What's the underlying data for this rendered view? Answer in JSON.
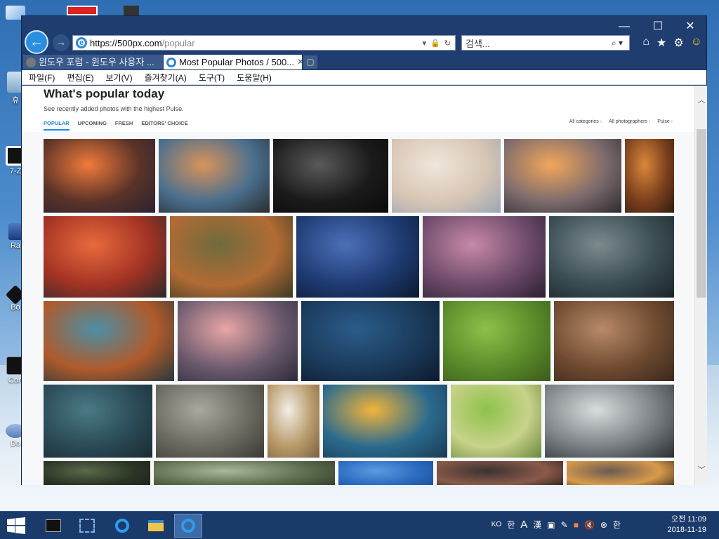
{
  "desktop": {
    "icons": [
      {
        "name": "desktop-icon-recycle",
        "label": "휴"
      },
      {
        "name": "desktop-icon-7zip",
        "label": "7-Z"
      },
      {
        "name": "desktop-icon-ra",
        "label": "Ra"
      },
      {
        "name": "desktop-icon-bo",
        "label": "Bo"
      },
      {
        "name": "desktop-icon-con",
        "label": "Con"
      },
      {
        "name": "desktop-icon-do",
        "label": "Do"
      }
    ]
  },
  "browser": {
    "address": {
      "host": "https://500px.com",
      "path": "/popular"
    },
    "search_placeholder": "검색...",
    "tabs": [
      {
        "label": "윈도우 포럼 - 윈도우 사용자 ...",
        "active": false
      },
      {
        "label": "Most Popular Photos / 500...",
        "active": true
      }
    ],
    "menu": [
      "파일(F)",
      "편집(E)",
      "보기(V)",
      "즐겨찾기(A)",
      "도구(T)",
      "도움말(H)"
    ],
    "window_controls": {
      "minimize": "—",
      "maximize": "☐",
      "close": "✕"
    }
  },
  "page": {
    "title": "What's popular today",
    "subtitle": "See recently added photos with the highest Pulse.",
    "subnav": [
      "POPULAR",
      "UPCOMING",
      "FRESH",
      "EDITORS' CHOICE"
    ],
    "active_subnav": "POPULAR",
    "filters": [
      "All categories",
      "All photographers",
      "Pulse"
    ],
    "photos": [
      {
        "name": "photo-mountain-sunset",
        "colors": [
          "#f07a3b",
          "#5a3328",
          "#2a2230"
        ]
      },
      {
        "name": "photo-lake-rocks",
        "colors": [
          "#d9935a",
          "#4a6f8e",
          "#2a2c2e"
        ]
      },
      {
        "name": "photo-bw-portrait",
        "colors": [
          "#5a5a5a",
          "#1a1a1a",
          "#0a0a0a"
        ]
      },
      {
        "name": "photo-woman-dress",
        "colors": [
          "#efe6dc",
          "#d8c6b4",
          "#9aa5b6"
        ]
      },
      {
        "name": "photo-mountain-clouds",
        "colors": [
          "#f2a75a",
          "#7c6b6d",
          "#2e2a2e"
        ]
      },
      {
        "name": "photo-autumn-forest",
        "colors": [
          "#d9883a",
          "#7a3f1c",
          "#2f1c10"
        ]
      },
      {
        "name": "photo-red-sky",
        "colors": [
          "#e86b3c",
          "#a23224",
          "#2a2a2a"
        ]
      },
      {
        "name": "photo-squirrels",
        "colors": [
          "#6f6b3d",
          "#b26b34",
          "#3a3a24"
        ]
      },
      {
        "name": "photo-lake-reflection",
        "colors": [
          "#4c70b8",
          "#1e3a72",
          "#0d1a2e"
        ]
      },
      {
        "name": "photo-cypress-pink",
        "colors": [
          "#c88aa8",
          "#6e4a6a",
          "#2a2030"
        ]
      },
      {
        "name": "photo-sea-cliffs",
        "colors": [
          "#7c8a8e",
          "#3a4c52",
          "#1a2428"
        ]
      },
      {
        "name": "photo-boats-dock",
        "colors": [
          "#4a8fa6",
          "#b05a2a",
          "#25383e"
        ]
      },
      {
        "name": "photo-pier-sunset",
        "colors": [
          "#e8a6a6",
          "#6b5a6e",
          "#2c2a3a"
        ]
      },
      {
        "name": "photo-blue-swamp",
        "colors": [
          "#2b5c8a",
          "#1a3a5a",
          "#0d1a2c"
        ]
      },
      {
        "name": "photo-rabbit",
        "colors": [
          "#8bc24a",
          "#5a8a2a",
          "#3a5a1a"
        ]
      },
      {
        "name": "photo-couple-field",
        "colors": [
          "#b88a6a",
          "#6e4a30",
          "#3a281a"
        ]
      },
      {
        "name": "photo-cormorant",
        "colors": [
          "#4a7a86",
          "#2a4a56",
          "#1a2a30"
        ]
      },
      {
        "name": "photo-owl",
        "colors": [
          "#a8a89e",
          "#6a6a60",
          "#3a3a34"
        ]
      },
      {
        "name": "photo-sparrow",
        "colors": [
          "#f2eee6",
          "#b89a6a",
          "#7a6040"
        ]
      },
      {
        "name": "photo-beach-sunset",
        "colors": [
          "#f2b43a",
          "#2a6a8e",
          "#1a3a52"
        ]
      },
      {
        "name": "photo-tuscany",
        "colors": [
          "#8ec24a",
          "#c8d28a",
          "#6a8a3a"
        ]
      },
      {
        "name": "photo-misty-boat",
        "colors": [
          "#d8dcde",
          "#7a8084",
          "#2a2e30"
        ]
      },
      {
        "name": "photo-lily-boat",
        "colors": [
          "#5a6a4a",
          "#2a3424",
          "#1a201a"
        ]
      },
      {
        "name": "photo-tree-branches",
        "colors": [
          "#a8b89a",
          "#5a6a4a",
          "#2a3424"
        ]
      },
      {
        "name": "photo-blue-sky",
        "colors": [
          "#5a9ae0",
          "#2a6abe",
          "#1a4a8e"
        ]
      },
      {
        "name": "photo-woman-portrait",
        "colors": [
          "#3a3230",
          "#8a5a4a",
          "#1a1614"
        ]
      },
      {
        "name": "photo-woman-candles",
        "colors": [
          "#6a5a52",
          "#d89a4a",
          "#2a2420"
        ]
      }
    ]
  },
  "taskbar": {
    "tray_text": [
      "KO",
      "한",
      "A",
      "漢"
    ],
    "ime": "한",
    "clock": {
      "time": "오전 11:09",
      "date": "2018-11-19"
    }
  }
}
